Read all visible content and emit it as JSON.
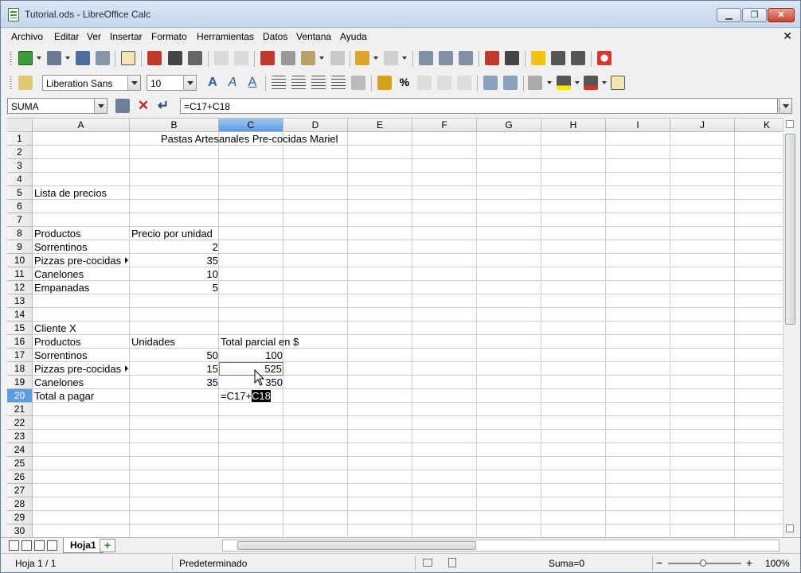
{
  "window": {
    "title": "Tutorial.ods - LibreOffice Calc"
  },
  "menu": [
    "Archivo",
    "Editar",
    "Ver",
    "Insertar",
    "Formato",
    "Herramientas",
    "Datos",
    "Ventana",
    "Ayuda"
  ],
  "format_bar": {
    "font_name": "Liberation Sans",
    "font_size": "10"
  },
  "formula_bar": {
    "name_box": "SUMA",
    "formula": "=C17+C18"
  },
  "columns": [
    "A",
    "B",
    "C",
    "D",
    "E",
    "F",
    "G",
    "H",
    "I",
    "J",
    "K"
  ],
  "active_column": "C",
  "active_row": "20",
  "rows": [
    "1",
    "2",
    "3",
    "4",
    "5",
    "6",
    "7",
    "8",
    "9",
    "10",
    "11",
    "12",
    "13",
    "14",
    "15",
    "16",
    "17",
    "18",
    "19",
    "20",
    "21",
    "22",
    "23",
    "24",
    "25",
    "26",
    "27",
    "28",
    "29",
    "30"
  ],
  "cells": {
    "r1_title": "Pastas Artesanales Pre-cocidas Mariel",
    "r5_a": "Lista de precios",
    "r8_a": "Productos",
    "r8_b": "Precio por unidad",
    "r9_a": "Sorrentinos",
    "r9_b": "2",
    "r10_a": "Pizzas pre-cocidas",
    "r10_b": "35",
    "r11_a": "Canelones",
    "r11_b": "10",
    "r12_a": "Empanadas",
    "r12_b": "5",
    "r15_a": "Cliente X",
    "r16_a": "Productos",
    "r16_b": "Unidades",
    "r16_c": "Total parcial en $",
    "r17_a": "Sorrentinos",
    "r17_b": "50",
    "r17_c": "100",
    "r18_a": "Pizzas pre-cocidas",
    "r18_b": "15",
    "r18_c": "525",
    "r19_a": "Canelones",
    "r19_b": "35",
    "r19_c": "350",
    "r20_a": "Total a pagar",
    "r20_c_prefix": "=C17+",
    "r20_c_selected": "C18"
  },
  "sheet_tabs": {
    "active": "Hoja1"
  },
  "statusbar": {
    "sheet": "Hoja 1 / 1",
    "style": "Predeterminado",
    "sum": "Suma=0",
    "zoom": "100%"
  },
  "colors": {
    "active_header": "#5a9de4",
    "formula_ref_border": "#d63fd6",
    "titlebar": "#c6d6ec"
  }
}
